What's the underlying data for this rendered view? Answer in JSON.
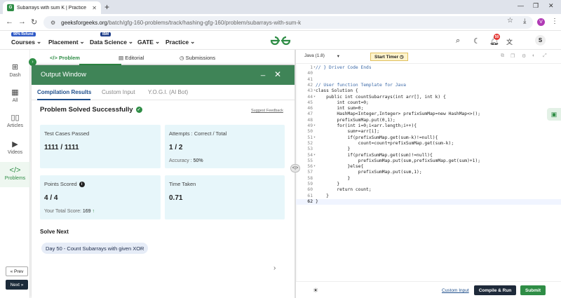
{
  "browser": {
    "tab_title": "Subarrays with sum K | Practice",
    "url_host": "geeksforgeeks.org",
    "url_path": "/batch/gfg-160-problems/track/hashing-gfg-160/problem/subarrays-with-sum-k",
    "profile_initial": "V"
  },
  "header": {
    "courses_badge": "90% Refund",
    "courses": "Courses",
    "placement": "Placement",
    "data_science_badge": "IBM",
    "data_science": "Data Science",
    "gate": "GATE",
    "practice": "Practice",
    "notifications": "50",
    "avatar_initial": "S"
  },
  "rail": {
    "items": [
      {
        "label": "Dash",
        "icon": "dashboard-icon"
      },
      {
        "label": "All",
        "icon": "grid-icon"
      },
      {
        "label": "Articles",
        "icon": "book-icon"
      },
      {
        "label": "Videos",
        "icon": "video-icon"
      },
      {
        "label": "Problems",
        "icon": "code-icon"
      }
    ],
    "prev": "« Prev",
    "next": "Next »"
  },
  "problem_tabs": {
    "problem": "Problem",
    "editorial": "Editorial",
    "submissions": "Submissions"
  },
  "output": {
    "title": "Output Window",
    "tabs": [
      "Compilation Results",
      "Custom Input",
      "Y.O.G.I. (AI Bot)"
    ],
    "status": "Problem Solved Successfully",
    "feedback": "Suggest Feedback",
    "test_cases_label": "Test Cases Passed",
    "test_cases_value": "1111 / 1111",
    "attempts_label": "Attempts : Correct / Total",
    "attempts_value": "1 / 2",
    "accuracy_label": "Accuracy :",
    "accuracy_value": "50%",
    "points_label": "Points Scored",
    "points_value": "4 / 4",
    "total_score_label": "Your Total Score:",
    "total_score_value": "169",
    "time_label": "Time Taken",
    "time_value": "0.71",
    "solve_next_label": "Solve Next",
    "next_problem": "Day 50 - Count Subarrays with given XOR"
  },
  "editor": {
    "language": "Java (1.8)",
    "timer": "Start Timer",
    "lines": [
      {
        "n": "1",
        "text": "// } Driver Code Ends",
        "cls": "comment",
        "fold": true
      },
      {
        "n": "40",
        "text": ""
      },
      {
        "n": "41",
        "text": ""
      },
      {
        "n": "42",
        "text": "// User function Template for Java",
        "cls": "comment"
      },
      {
        "n": "43",
        "text": "class Solution {",
        "fold": true
      },
      {
        "n": "44",
        "text": "    public int countSubarrays(int arr[], int k) {",
        "fold": true
      },
      {
        "n": "45",
        "text": "        int count=0;"
      },
      {
        "n": "46",
        "text": "        int sum=0;"
      },
      {
        "n": "47",
        "text": "        HashMap<Integer,Integer> prefixSumMap=new HashMap<>();"
      },
      {
        "n": "48",
        "text": "        prefixSumMap.put(0,1);"
      },
      {
        "n": "49",
        "text": "        for(int i=0;i<arr.length;i++){",
        "fold": true
      },
      {
        "n": "50",
        "text": "            sum+=arr[i];"
      },
      {
        "n": "51",
        "text": "            if(prefixSumMap.get(sum-k)!=null){",
        "fold": true
      },
      {
        "n": "52",
        "text": "                count=count+prefixSumMap.get(sum-k);"
      },
      {
        "n": "53",
        "text": "            }"
      },
      {
        "n": "54",
        "text": "            if(prefixSumMap.get(sum)!=null){",
        "fold": true
      },
      {
        "n": "55",
        "text": "                prefixSumMap.put(sum,prefixSumMap.get(sum)+1);"
      },
      {
        "n": "56",
        "text": "            }else{",
        "fold": true
      },
      {
        "n": "57",
        "text": "                prefixSumMap.put(sum,1);"
      },
      {
        "n": "58",
        "text": "            }"
      },
      {
        "n": "59",
        "text": "        }"
      },
      {
        "n": "60",
        "text": "        return count;"
      },
      {
        "n": "61",
        "text": "    }"
      },
      {
        "n": "62",
        "text": "}"
      }
    ],
    "custom_input": "Custom Input",
    "compile": "Compile & Run",
    "submit": "Submit"
  }
}
